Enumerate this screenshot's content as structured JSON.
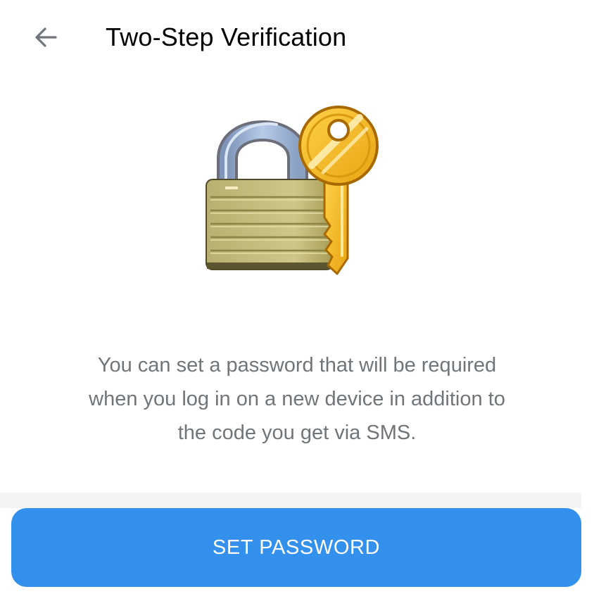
{
  "header": {
    "back_icon": "arrow-left-icon",
    "title": "Two-Step Verification"
  },
  "illustration": {
    "icon": "lock-with-key-icon"
  },
  "description": {
    "line1": "You can set a password that will be required",
    "line2": "when you log in on a new device in addition to",
    "line3": "the code you get via SMS."
  },
  "actions": {
    "set_password_label": "SET PASSWORD"
  },
  "colors": {
    "accent": "#3390ec",
    "text_secondary": "#707579",
    "divider": "#f4f4f5"
  }
}
